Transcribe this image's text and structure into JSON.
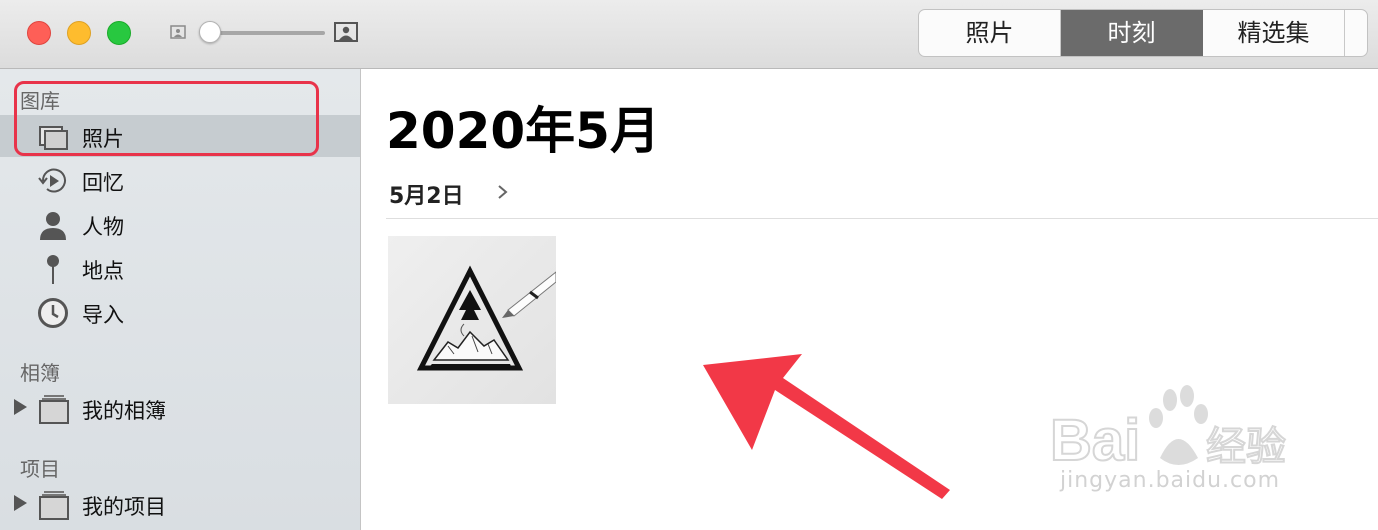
{
  "window": {
    "traffic_lights": {
      "close_color": "#fe5f57",
      "minimize_color": "#febc2e",
      "maximize_color": "#28c840"
    },
    "zoom_slider": {
      "level": 0.0
    },
    "view_tabs": [
      {
        "label": "照片",
        "active": false
      },
      {
        "label": "时刻",
        "active": true
      },
      {
        "label": "精选集",
        "active": false
      }
    ]
  },
  "sidebar": {
    "library": {
      "header": "图库",
      "items": [
        {
          "label": "照片",
          "icon": "photos-icon",
          "selected": true
        },
        {
          "label": "回忆",
          "icon": "memories-icon"
        },
        {
          "label": "人物",
          "icon": "person-icon"
        },
        {
          "label": "地点",
          "icon": "pin-icon"
        },
        {
          "label": "导入",
          "icon": "clock-icon"
        }
      ]
    },
    "albums": {
      "header": "相簿",
      "items": [
        {
          "label": "我的相簿",
          "icon": "album-stack-icon"
        }
      ]
    },
    "projects": {
      "header": "项目",
      "items": [
        {
          "label": "我的项目",
          "icon": "album-stack-icon"
        }
      ]
    }
  },
  "main": {
    "month_title": "2020年5月",
    "day_label": "5月2日",
    "photos": [
      {
        "icon": "photo-thumbnail-triangle-mountain"
      }
    ]
  },
  "annotations": {
    "highlight_color": "#e8334a",
    "arrow_color": "#f23847"
  },
  "watermark": {
    "brand": "Bai经验",
    "url": "jingyan.baidu.com"
  }
}
